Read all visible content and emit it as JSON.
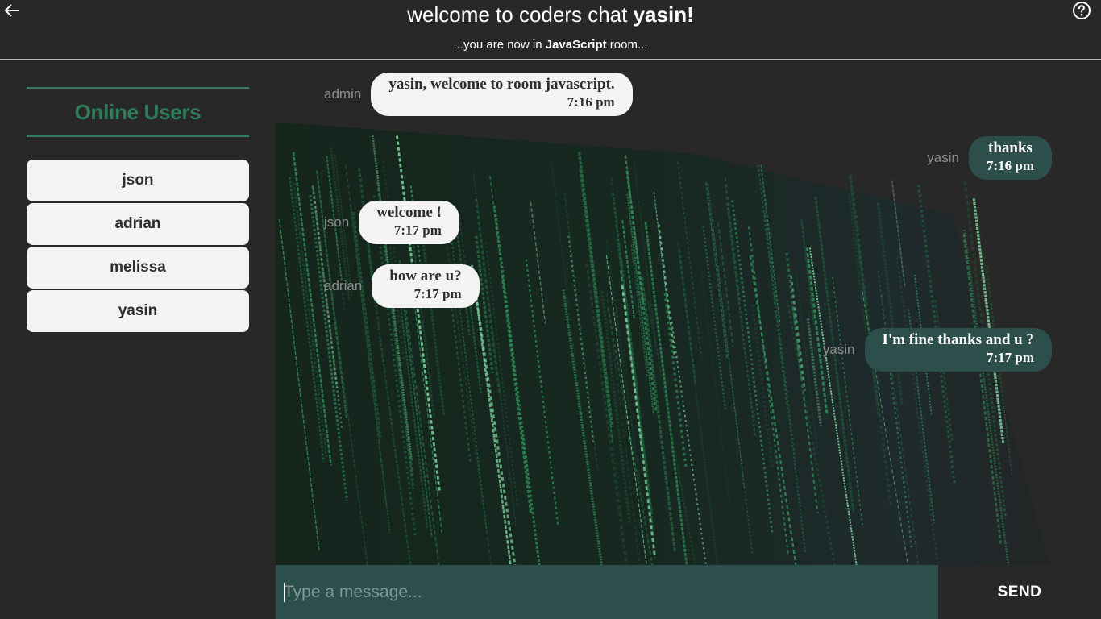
{
  "header": {
    "title_prefix": "welcome to coders chat ",
    "username": "yasin!",
    "subtitle_prefix": "...you are now in ",
    "room": "JavaScript",
    "subtitle_suffix": " room...",
    "back_icon": "arrow-left-icon",
    "help_icon": "question-circle-icon"
  },
  "sidebar": {
    "heading": "Online Users",
    "users": [
      {
        "name": "json"
      },
      {
        "name": "adrian"
      },
      {
        "name": "melissa"
      },
      {
        "name": "yasin"
      }
    ]
  },
  "messages": [
    {
      "sender": "admin",
      "text": "yasin, welcome to room javascript.",
      "time": "7:16 pm",
      "direction": "incoming"
    },
    {
      "sender": "yasin",
      "text": "thanks",
      "time": "7:16 pm",
      "direction": "outgoing"
    },
    {
      "sender": "json",
      "text": "welcome !",
      "time": "7:17 pm",
      "direction": "incoming"
    },
    {
      "sender": "adrian",
      "text": "how are u?",
      "time": "7:17 pm",
      "direction": "incoming"
    },
    {
      "sender": "yasin",
      "text": "I'm fine thanks and u ?",
      "time": "7:17 pm",
      "direction": "outgoing"
    }
  ],
  "composer": {
    "placeholder": "Type a message...",
    "value": "",
    "send_label": "SEND"
  },
  "colors": {
    "background": "#282828",
    "accent_green": "#2e7d5b",
    "outgoing_bubble": "#2c4f4c",
    "incoming_bubble": "#f3f3f3"
  }
}
